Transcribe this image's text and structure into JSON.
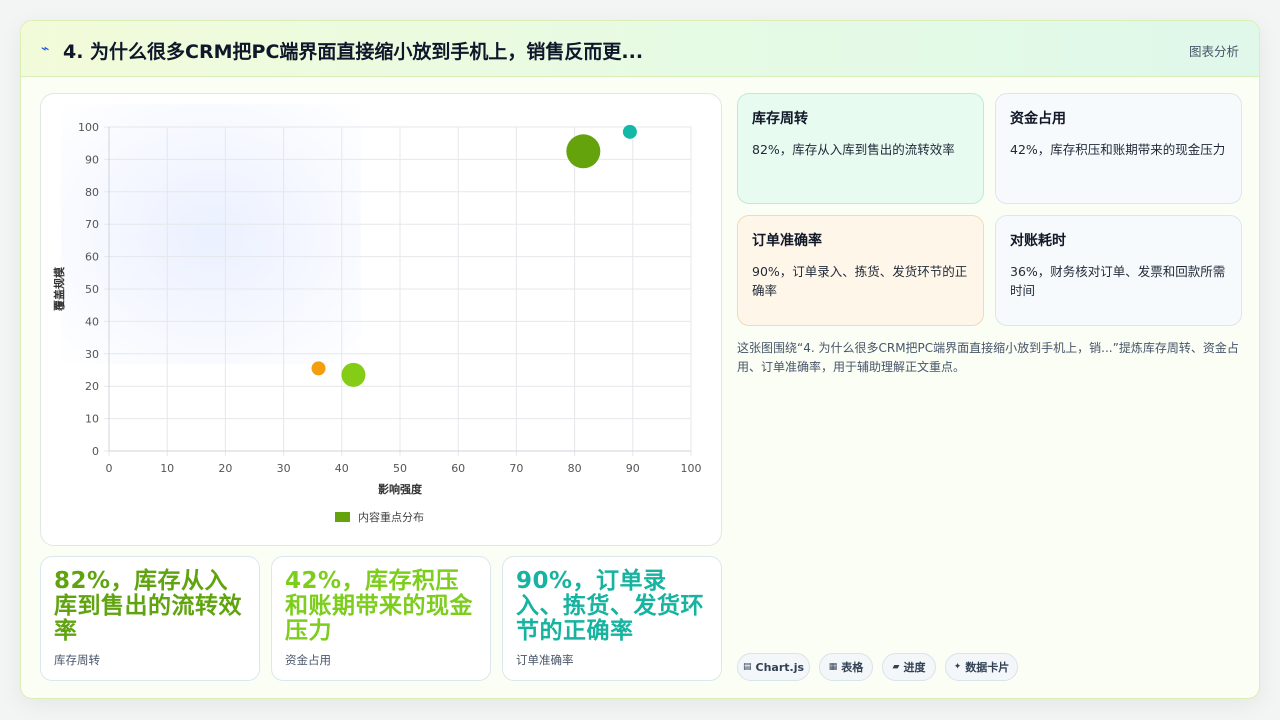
{
  "header": {
    "title": "4. 为什么很多CRM把PC端界面直接缩小放到手机上，销售反而更...",
    "tag": "图表分析"
  },
  "chart_data": {
    "type": "bubble",
    "xlabel": "影响强度",
    "ylabel": "覆盖规模",
    "xlim": [
      0,
      100
    ],
    "ylim": [
      0,
      100
    ],
    "xticks": [
      0,
      10,
      20,
      30,
      40,
      50,
      60,
      70,
      80,
      90,
      100
    ],
    "yticks": [
      0,
      10,
      20,
      30,
      40,
      50,
      60,
      70,
      80,
      90,
      100
    ],
    "grid": true,
    "legend": {
      "position": "bottom",
      "label": "内容重点分布",
      "color": "#65a30d"
    },
    "points": [
      {
        "x": 89.5,
        "y": 98.5,
        "r": 7,
        "color": "#14b8a6"
      },
      {
        "x": 81.5,
        "y": 92.5,
        "r": 17,
        "color": "#65a30d"
      },
      {
        "x": 36,
        "y": 25.5,
        "r": 7,
        "color": "#f59e0b"
      },
      {
        "x": 42,
        "y": 23.5,
        "r": 12,
        "color": "#84cc16"
      }
    ]
  },
  "metrics": [
    {
      "title": "库存周转",
      "desc": "82%，库存从入库到售出的流转效率"
    },
    {
      "title": "资金占用",
      "desc": "42%，库存积压和账期带来的现金压力"
    },
    {
      "title": "订单准确率",
      "desc": "90%，订单录入、拣货、发货环节的正确率"
    },
    {
      "title": "对账耗时",
      "desc": "36%，财务核对订单、发票和回款所需时间"
    }
  ],
  "caption": "这张图围绕“4. 为什么很多CRM把PC端界面直接缩小放到手机上，销...”提炼库存周转、资金占用、订单准确率，用于辅助理解正文重点。",
  "highlights": [
    {
      "big": "82%，库存从入库到售出的流转效率",
      "small": "库存周转",
      "color": "#5fa40f"
    },
    {
      "big": "42%，库存积压和账期带来的现金压力",
      "small": "资金占用",
      "color": "#7ccd1c"
    },
    {
      "big": "90%，订单录入、拣货、发货环节的正确率",
      "small": "订单准确率",
      "color": "#16b3a0"
    }
  ],
  "pills": [
    {
      "icon": "▤",
      "label": "Chart.js"
    },
    {
      "icon": "▦",
      "label": "表格"
    },
    {
      "icon": "▰",
      "label": "进度"
    },
    {
      "icon": "✦",
      "label": "数据卡片"
    }
  ]
}
